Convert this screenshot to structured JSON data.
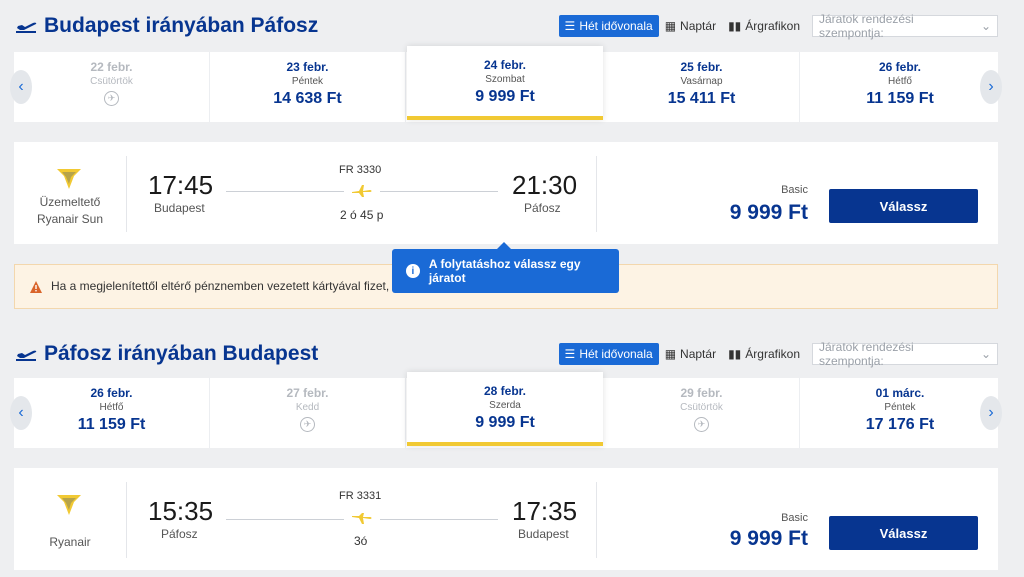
{
  "outbound": {
    "title": "Budapest irányában Páfosz",
    "view_tabs": [
      "Hét idővonala",
      "Naptár",
      "Árgrafikon"
    ],
    "sort_placeholder": "Járatok rendezési szempontja:",
    "dates": [
      {
        "date": "22 febr.",
        "weekday": "Csütörtök",
        "price": "",
        "disabled": true
      },
      {
        "date": "23 febr.",
        "weekday": "Péntek",
        "price": "14 638 Ft"
      },
      {
        "date": "24 febr.",
        "weekday": "Szombat",
        "price": "9 999 Ft",
        "active": true
      },
      {
        "date": "25 febr.",
        "weekday": "Vasárnap",
        "price": "15 411 Ft"
      },
      {
        "date": "26 febr.",
        "weekday": "Hétfő",
        "price": "11 159 Ft"
      }
    ],
    "flight": {
      "operator_label": "Üzemeltető",
      "operator_name": "Ryanair Sun",
      "depart_time": "17:45",
      "depart_city": "Budapest",
      "flight_no": "FR 3330",
      "duration": "2 ó 45 p",
      "arrive_time": "21:30",
      "arrive_city": "Páfosz",
      "fare_type": "Basic",
      "price": "9 999 Ft",
      "select_label": "Válassz"
    }
  },
  "warning_text": "Ha a megjelenítettől eltérő pénznemben vezetett kártyával fizet, a",
  "tooltip_text": "A folytatáshoz válassz egy járatot",
  "inbound": {
    "title": "Páfosz irányában Budapest",
    "view_tabs": [
      "Hét idővonala",
      "Naptár",
      "Árgrafikon"
    ],
    "sort_placeholder": "Járatok rendezési szempontja:",
    "dates": [
      {
        "date": "26 febr.",
        "weekday": "Hétfő",
        "price": "11 159 Ft"
      },
      {
        "date": "27 febr.",
        "weekday": "Kedd",
        "price": "",
        "disabled": true
      },
      {
        "date": "28 febr.",
        "weekday": "Szerda",
        "price": "9 999 Ft",
        "active": true
      },
      {
        "date": "29 febr.",
        "weekday": "Csütörtök",
        "price": "",
        "disabled": true
      },
      {
        "date": "01 márc.",
        "weekday": "Péntek",
        "price": "17 176 Ft"
      }
    ],
    "flight": {
      "operator_label": "",
      "operator_name": "Ryanair",
      "depart_time": "15:35",
      "depart_city": "Páfosz",
      "flight_no": "FR 3331",
      "duration": "3ó",
      "arrive_time": "17:35",
      "arrive_city": "Budapest",
      "fare_type": "Basic",
      "price": "9 999 Ft",
      "select_label": "Válassz"
    }
  },
  "colors": {
    "brand_navy": "#073590",
    "accent_blue": "#1a6ad6",
    "highlight_yellow": "#f1c933"
  }
}
